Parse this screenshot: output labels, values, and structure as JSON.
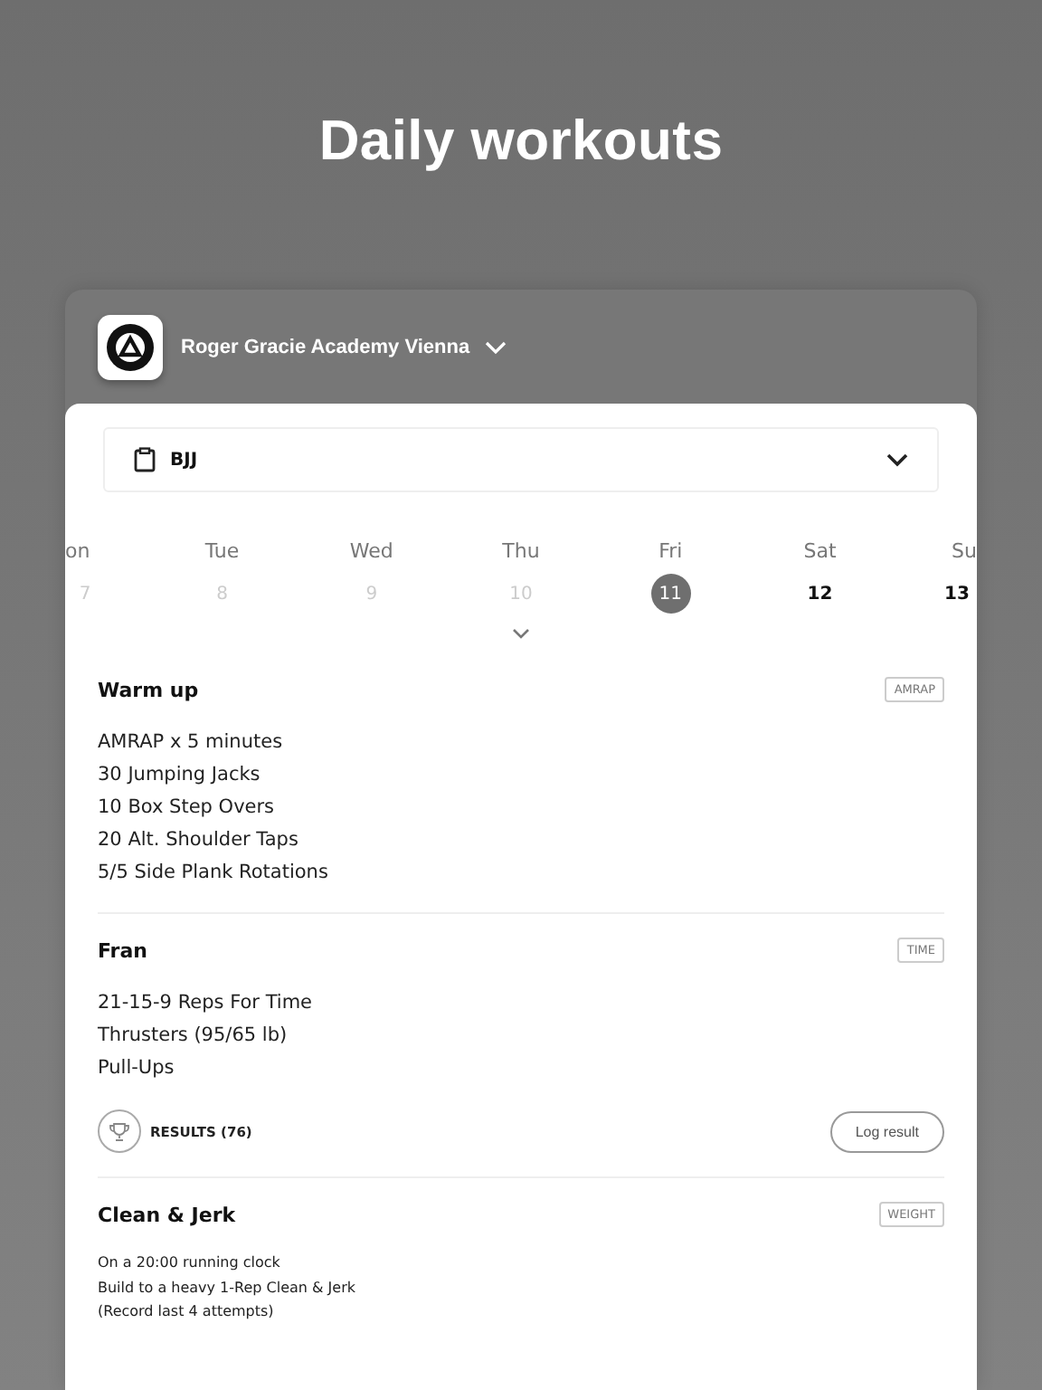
{
  "headline": "Daily workouts",
  "gym": {
    "name": "Roger Gracie Academy Vienna"
  },
  "program": {
    "value": "BJJ"
  },
  "days": [
    {
      "weekday": "on",
      "date": "7",
      "past": true,
      "selected": false
    },
    {
      "weekday": "Tue",
      "date": "8",
      "past": true,
      "selected": false
    },
    {
      "weekday": "Wed",
      "date": "9",
      "past": true,
      "selected": false
    },
    {
      "weekday": "Thu",
      "date": "10",
      "past": true,
      "selected": false
    },
    {
      "weekday": "Fri",
      "date": "11",
      "past": false,
      "selected": true
    },
    {
      "weekday": "Sat",
      "date": "12",
      "past": false,
      "selected": false
    },
    {
      "weekday": "Su",
      "date": "13",
      "past": false,
      "selected": false
    }
  ],
  "workouts": [
    {
      "title": "Warm up",
      "tag": "AMRAP",
      "small": false,
      "lines": [
        "AMRAP x 5 minutes",
        "30 Jumping Jacks",
        "10 Box Step Overs",
        "20 Alt. Shoulder Taps",
        "5/5 Side Plank Rotations"
      ]
    },
    {
      "title": "Fran",
      "tag": "TIME",
      "small": false,
      "lines": [
        "21-15-9 Reps For Time",
        "Thrusters (95/65 lb)",
        "Pull-Ups"
      ],
      "results": "RESULTS (76)",
      "log_button": "Log result"
    },
    {
      "title": "Clean & Jerk",
      "tag": "WEIGHT",
      "small": true,
      "lines": [
        "On a 20:00 running clock",
        "Build to a heavy 1-Rep Clean & Jerk",
        "(Record last 4 attempts)"
      ]
    }
  ]
}
